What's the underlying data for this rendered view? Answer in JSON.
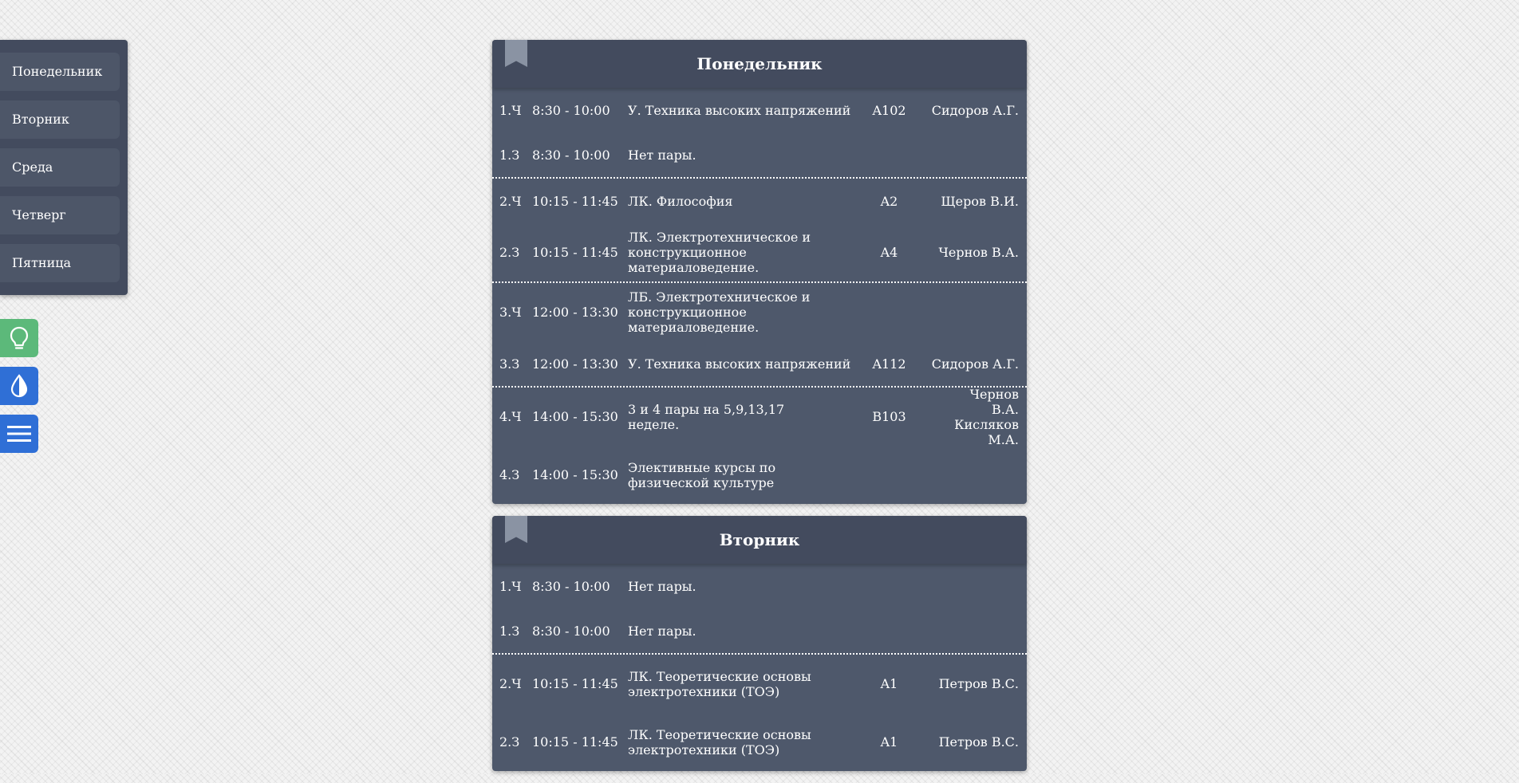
{
  "nav": {
    "days": [
      "Понедельник",
      "Вторник",
      "Среда",
      "Четверг",
      "Пятница"
    ]
  },
  "tools": {
    "lamp": "lightbulb-icon",
    "theme": "droplet-icon",
    "menu": "hamburger-menu-icon"
  },
  "schedule": [
    {
      "day": "Понедельник",
      "groups": [
        [
          {
            "num": "1.Ч",
            "time": "8:30 - 10:00",
            "subject": "У. Техника высоких напряжений",
            "room": "A102",
            "teacher": "Сидоров А.Г."
          },
          {
            "num": "1.З",
            "time": "8:30 - 10:00",
            "subject": "Нет пары.",
            "room": "",
            "teacher": ""
          }
        ],
        [
          {
            "num": "2.Ч",
            "time": "10:15 - 11:45",
            "subject": "ЛК. Философия",
            "room": "A2",
            "teacher": "Щеров В.И."
          },
          {
            "num": "2.З",
            "time": "10:15 - 11:45",
            "subject": "ЛК. Электротехническое и конструкционное материаловедение.",
            "room": "A4",
            "teacher": "Чернов В.А."
          }
        ],
        [
          {
            "num": "3.Ч",
            "time": "12:00 - 13:30",
            "subject": "ЛБ. Электротехническое и конструкционное материаловедение.",
            "room": "",
            "teacher": ""
          },
          {
            "num": "3.З",
            "time": "12:00 - 13:30",
            "subject": "У. Техника высоких напряжений",
            "room": "A112",
            "teacher": "Сидоров А.Г."
          }
        ],
        [
          {
            "num": "4.Ч",
            "time": "14:00 - 15:30",
            "subject": "3 и 4 пары на 5,9,13,17 неделе.",
            "room": "B103",
            "teacher": "Чернов В.А. Кисляков М.А."
          },
          {
            "num": "4.З",
            "time": "14:00 - 15:30",
            "subject": "Элективные курсы по физической культуре",
            "room": "",
            "teacher": ""
          }
        ]
      ]
    },
    {
      "day": "Вторник",
      "groups": [
        [
          {
            "num": "1.Ч",
            "time": "8:30 - 10:00",
            "subject": "Нет пары.",
            "room": "",
            "teacher": ""
          },
          {
            "num": "1.З",
            "time": "8:30 - 10:00",
            "subject": "Нет пары.",
            "room": "",
            "teacher": ""
          }
        ],
        [
          {
            "num": "2.Ч",
            "time": "10:15 - 11:45",
            "subject": "ЛК. Теоретические основы электротехники (ТОЭ)",
            "room": "A1",
            "teacher": "Петров В.С."
          },
          {
            "num": "2.З",
            "time": "10:15 - 11:45",
            "subject": "ЛК. Теоретические основы электротехники (ТОЭ)",
            "room": "A1",
            "teacher": "Петров В.С."
          }
        ]
      ]
    }
  ]
}
